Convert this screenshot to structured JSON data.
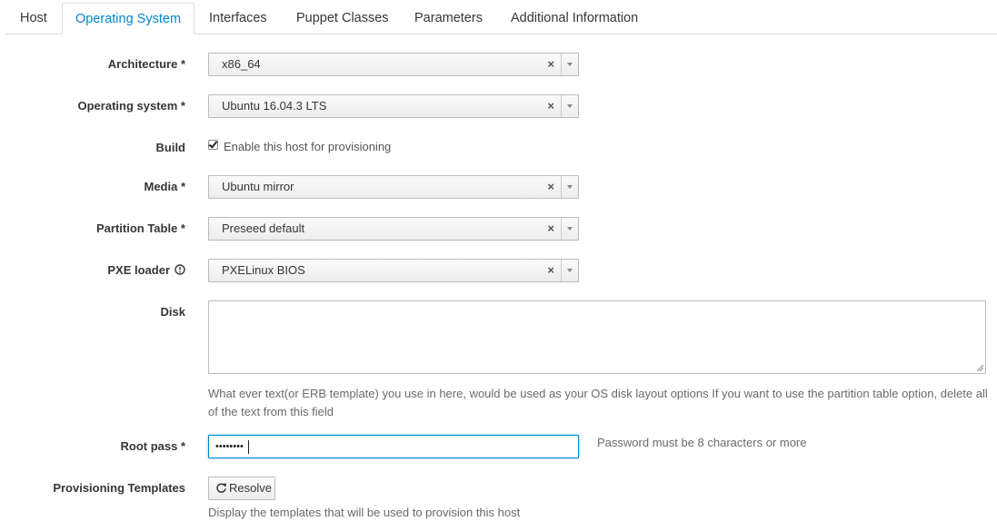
{
  "tabs": [
    {
      "label": "Host"
    },
    {
      "label": "Operating System",
      "active": true
    },
    {
      "label": "Interfaces"
    },
    {
      "label": "Puppet Classes"
    },
    {
      "label": "Parameters"
    },
    {
      "label": "Additional Information"
    }
  ],
  "form": {
    "architecture": {
      "label": "Architecture *",
      "value": "x86_64"
    },
    "operating_system": {
      "label": "Operating system *",
      "value": "Ubuntu 16.04.3 LTS"
    },
    "build": {
      "label": "Build",
      "checkbox_label": "Enable this host for provisioning",
      "checked": true
    },
    "media": {
      "label": "Media *",
      "value": "Ubuntu mirror"
    },
    "partition_table": {
      "label": "Partition Table *",
      "value": "Preseed default"
    },
    "pxe_loader": {
      "label": "PXE loader",
      "value": "PXELinux BIOS",
      "icon": "info-icon"
    },
    "disk": {
      "label": "Disk",
      "value": "",
      "help": "What ever text(or ERB template) you use in here, would be used as your OS disk layout options If you want to use the partition table option, delete all of the text from this field"
    },
    "root_pass": {
      "label": "Root pass *",
      "masked_value": "••••••••",
      "help": "Password must be 8 characters or more"
    },
    "provisioning_templates": {
      "label": "Provisioning Templates",
      "button_label": "Resolve",
      "button_icon": "refresh-icon",
      "help": "Display the templates that will be used to provision this host"
    }
  },
  "clear_glyph": "×",
  "colors": {
    "accent": "#0088ce",
    "text": "#363636",
    "help": "#6a6a6a",
    "border": "#bbbbbb"
  }
}
